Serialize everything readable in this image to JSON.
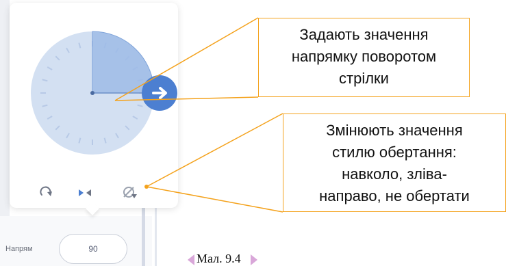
{
  "colors": {
    "dial_face": "#d3e0f2",
    "dial_sector": "#9dbbe6",
    "handle": "#4c7fd1",
    "callout_border": "#f4a21c",
    "leader_line": "#f4a21c",
    "caption_triangle": "#d9a7d9"
  },
  "dial": {
    "direction_degrees": 90,
    "handle_icon": "arrow-right-icon"
  },
  "rotation_styles": [
    {
      "name": "all-around",
      "icon": "circular-arrow-icon"
    },
    {
      "name": "left-right",
      "icon": "left-right-arrows-icon"
    },
    {
      "name": "dont-rotate",
      "icon": "no-rotate-icon"
    }
  ],
  "direction_field": {
    "label": "Напрям",
    "value": "90"
  },
  "callouts": {
    "top": {
      "lines": [
        "Задають значення",
        "напрямку поворотом",
        "стрілки"
      ]
    },
    "bottom": {
      "lines": [
        "Змінюють значення",
        "стилю обертання:",
        "навколо, зліва-",
        "направо, не обертати"
      ]
    }
  },
  "caption": "Мал. 9.4"
}
